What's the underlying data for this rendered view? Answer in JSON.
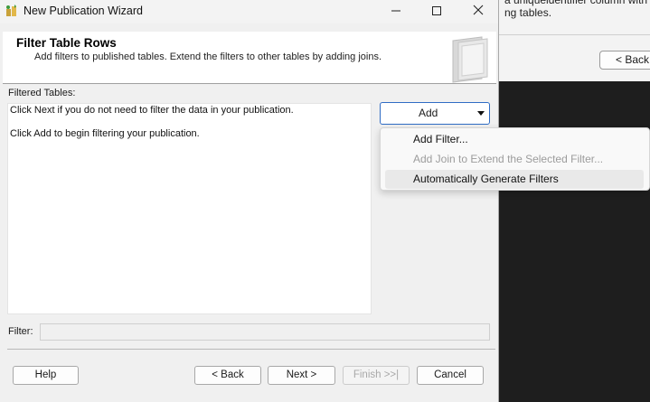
{
  "background_window": {
    "text_lines": "a uniqueidentifier column with a d\nng tables.",
    "back_label": "< Back"
  },
  "window": {
    "title": "New Publication Wizard"
  },
  "header": {
    "title": "Filter Table Rows",
    "subtitle": "Add filters to published tables. Extend the filters to other tables by adding joins."
  },
  "filtered_tables": {
    "label": "Filtered Tables:",
    "hint_next": "Click Next if you do not need to filter the data in your publication.",
    "hint_add": "Click Add to begin filtering your publication."
  },
  "add_dropdown": {
    "label": "Add",
    "menu": [
      {
        "label": "Add Filter...",
        "enabled": true
      },
      {
        "label": "Add Join to Extend the Selected Filter...",
        "enabled": false
      },
      {
        "label": "Automatically Generate Filters",
        "enabled": true,
        "hovered": true
      }
    ]
  },
  "filter": {
    "label": "Filter:",
    "value": ""
  },
  "buttons": {
    "help": "Help",
    "back": "< Back",
    "next": "Next >",
    "finish": "Finish >>|",
    "cancel": "Cancel"
  },
  "icons": [
    "wizard-app-icon",
    "minimize-icon",
    "maximize-icon",
    "close-icon",
    "publication-graphic-icon",
    "chevron-down-icon"
  ],
  "colors": {
    "accent_border": "#2f6cc4",
    "disabled_text": "#9c9c9c"
  }
}
